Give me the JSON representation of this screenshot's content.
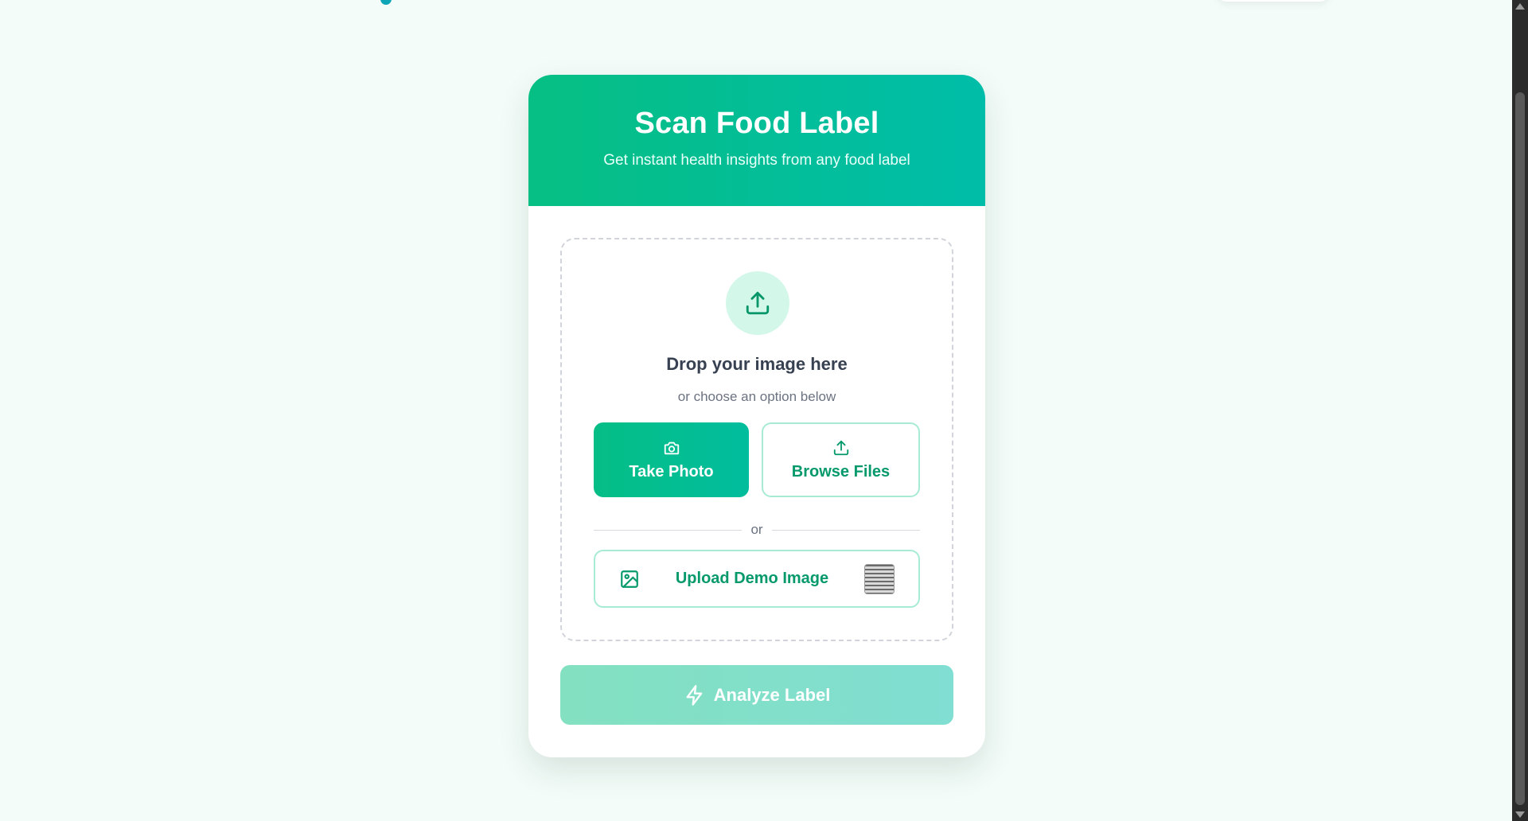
{
  "card": {
    "title": "Scan Food Label",
    "subtitle": "Get instant health insights from any food label"
  },
  "dropzone": {
    "icon": "upload-icon",
    "title": "Drop your image here",
    "subtitle": "or choose an option below"
  },
  "buttons": {
    "take_photo": {
      "label": "Take Photo",
      "icon": "camera-icon"
    },
    "browse_files": {
      "label": "Browse Files",
      "icon": "upload-icon"
    },
    "divider_text": "or",
    "demo": {
      "label": "Upload Demo Image",
      "icon": "image-icon"
    },
    "analyze": {
      "label": "Analyze Label",
      "icon": "lightning-icon",
      "disabled": true
    }
  },
  "colors": {
    "accent": "#05be86",
    "accent_teal": "#00bda9",
    "accent_text": "#06996b",
    "page_bg": "#f3fcf8"
  }
}
